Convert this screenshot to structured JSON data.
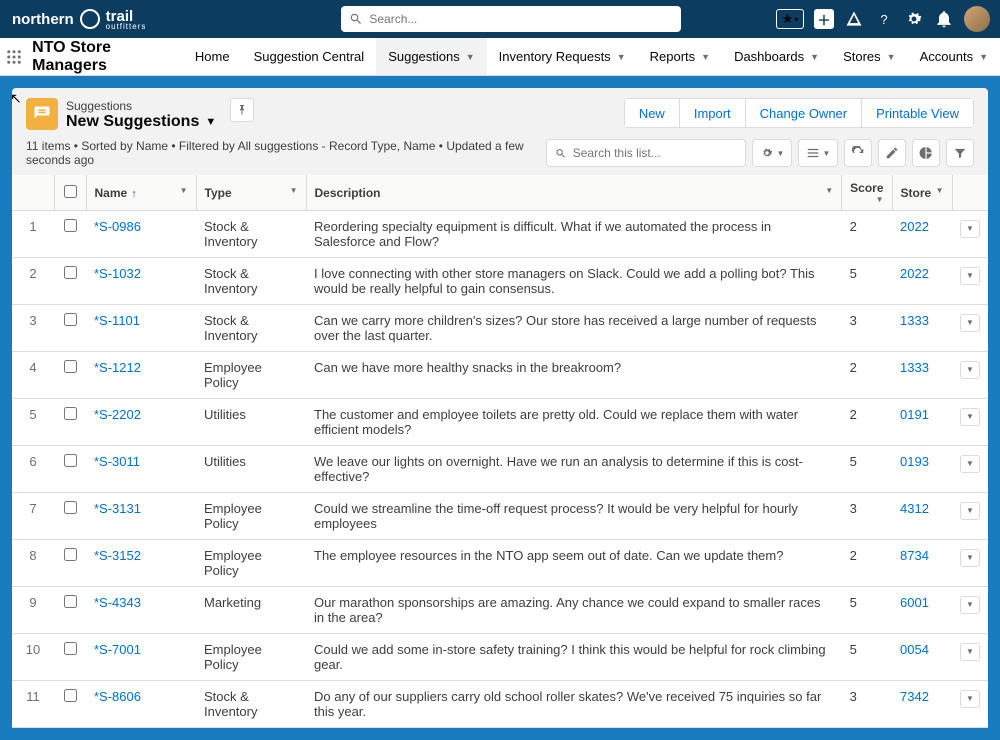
{
  "brand": {
    "main": "northern",
    "trail": "trail",
    "sub": "outfitters"
  },
  "globalSearch": {
    "placeholder": "Search..."
  },
  "appName": "NTO Store Managers",
  "nav": [
    {
      "label": "Home",
      "dd": false
    },
    {
      "label": "Suggestion Central",
      "dd": false
    },
    {
      "label": "Suggestions",
      "dd": true,
      "active": true
    },
    {
      "label": "Inventory Requests",
      "dd": true
    },
    {
      "label": "Reports",
      "dd": true
    },
    {
      "label": "Dashboards",
      "dd": true
    },
    {
      "label": "Stores",
      "dd": true
    },
    {
      "label": "Accounts",
      "dd": true
    }
  ],
  "list": {
    "object": "Suggestions",
    "viewName": "New Suggestions",
    "info": "11 items • Sorted by Name • Filtered by All suggestions - Record Type, Name • Updated a few seconds ago",
    "searchPlaceholder": "Search this list...",
    "actions": [
      "New",
      "Import",
      "Change Owner",
      "Printable View"
    ]
  },
  "columns": {
    "name": "Name",
    "type": "Type",
    "desc": "Description",
    "score": "Score",
    "store": "Store"
  },
  "rows": [
    {
      "n": "1",
      "name": "*S-0986",
      "type": "Stock & Inventory",
      "desc": "Reordering specialty equipment is difficult. What if we automated the process in Salesforce and Flow?",
      "score": "2",
      "store": "2022"
    },
    {
      "n": "2",
      "name": "*S-1032",
      "type": "Stock & Inventory",
      "desc": "I love connecting with other store managers on Slack. Could we add a polling bot? This would be really helpful to gain consensus.",
      "score": "5",
      "store": "2022"
    },
    {
      "n": "3",
      "name": "*S-1101",
      "type": "Stock & Inventory",
      "desc": "Can we carry more children's sizes? Our store has received a large number of requests over the last quarter.",
      "score": "3",
      "store": "1333"
    },
    {
      "n": "4",
      "name": "*S-1212",
      "type": "Employee Policy",
      "desc": "Can we have more healthy snacks in the breakroom?",
      "score": "2",
      "store": "1333"
    },
    {
      "n": "5",
      "name": "*S-2202",
      "type": "Utilities",
      "desc": "The customer and employee toilets are pretty old. Could we replace them with water efficient models?",
      "score": "2",
      "store": "0191"
    },
    {
      "n": "6",
      "name": "*S-3011",
      "type": "Utilities",
      "desc": "We leave our lights on overnight. Have we run an analysis to determine if this is cost-effective?",
      "score": "5",
      "store": "0193"
    },
    {
      "n": "7",
      "name": "*S-3131",
      "type": "Employee Policy",
      "desc": "Could we streamline the time-off request process? It would be very helpful for hourly employees",
      "score": "3",
      "store": "4312"
    },
    {
      "n": "8",
      "name": "*S-3152",
      "type": "Employee Policy",
      "desc": "The employee resources in the NTO app seem out of date. Can we update them?",
      "score": "2",
      "store": "8734"
    },
    {
      "n": "9",
      "name": "*S-4343",
      "type": "Marketing",
      "desc": "Our marathon sponsorships are amazing. Any chance we could expand to smaller races in the area?",
      "score": "5",
      "store": "6001"
    },
    {
      "n": "10",
      "name": "*S-7001",
      "type": "Employee Policy",
      "desc": "Could we add some in-store safety training? I think this would be helpful for rock climbing gear.",
      "score": "5",
      "store": "0054"
    },
    {
      "n": "11",
      "name": "*S-8606",
      "type": "Stock & Inventory",
      "desc": "Do any of our suppliers carry old school roller skates? We've received 75 inquiries so far this year.",
      "score": "3",
      "store": "7342"
    }
  ]
}
